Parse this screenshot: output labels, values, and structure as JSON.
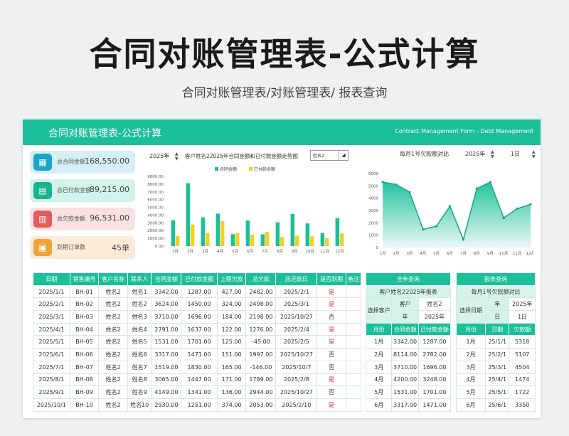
{
  "hero": {
    "title": "合同对账管理表-公式计算",
    "subtitle": "合同对账管理表/对账管理表/ 报表查询"
  },
  "header": {
    "title": "合同对账管理表-公式计算",
    "subtitle": "Contract Management Form - Debt Management"
  },
  "cards": [
    {
      "label": "总合同金额",
      "value": "168,550.00",
      "bg": "#d6eef6",
      "icon_bg": "#1aa6c8",
      "icon": "table-icon"
    },
    {
      "label": "总已付款金额",
      "value": "89,215.00",
      "bg": "#d3f3ea",
      "icon_bg": "#17b58e",
      "icon": "document-icon"
    },
    {
      "label": "总欠款金额",
      "value": "96,531.00",
      "bg": "#fae0e0",
      "icon_bg": "#e25c5c",
      "icon": "chart-icon"
    },
    {
      "label": "到期订单数",
      "value": "45单",
      "bg": "#fcebd7",
      "icon_bg": "#f0a33a",
      "icon": "calendar-icon"
    }
  ],
  "chart1": {
    "year": "2025年",
    "title": "客户姓名22025年合同金额和已付款金额走势图",
    "select": "姓名2"
  },
  "chart2": {
    "title": "每月1号欠款额对比",
    "year": "2025年",
    "day": "1日"
  },
  "chart_data": [
    {
      "type": "bar",
      "title": "客户姓名22025年合同金额和已付款金额走势图",
      "categories": [
        "1月",
        "2月",
        "3月",
        "4月",
        "5月",
        "6月",
        "7月",
        "8月",
        "9月",
        "10月",
        "11月",
        "12月"
      ],
      "yticks": [
        "9000.00",
        "8000.00",
        "7000.00",
        "6000.00",
        "5000.00",
        "4000.00",
        "3000.00",
        "2000.00",
        "1000.00",
        "0.00"
      ],
      "ylim": [
        0,
        9000
      ],
      "legend_position": "top",
      "series": [
        {
          "name": "合同金额",
          "color": "#1bbf98",
          "values": [
            3342,
            8114,
            3710,
            4200,
            1531,
            3317,
            1519,
            3065,
            4149,
            2930,
            1680,
            3620
          ]
        },
        {
          "name": "已付款金额",
          "color": "#f2d024",
          "values": [
            1287,
            2782,
            1696,
            3248,
            1701,
            1471,
            1830,
            1147,
            1341,
            1251,
            1050,
            1620
          ]
        }
      ]
    },
    {
      "type": "area",
      "title": "每月1号欠款额对比",
      "categories": [
        "1月",
        "2月",
        "3月",
        "4月",
        "5月",
        "6月",
        "7月",
        "8月",
        "9月",
        "10月",
        "11月",
        "12月"
      ],
      "yticks": [
        "6000",
        "5000",
        "4000",
        "3000",
        "2000",
        "1000",
        "0"
      ],
      "ylim": [
        0,
        6000
      ],
      "values": [
        5318,
        5107,
        4504,
        1474,
        1722,
        3350,
        650,
        4780,
        5300,
        2400,
        3150,
        3500
      ]
    }
  ],
  "main_table": {
    "headers": [
      "日期",
      "销售编号",
      "客户名称",
      "联系人",
      "合同金额",
      "已付款金额",
      "上期欠款",
      "总欠款",
      "应还款日",
      "是否到期",
      "备注"
    ],
    "rows": [
      [
        "2025/1/1",
        "BH-01",
        "姓名2",
        "姓名1",
        "3342.00",
        "1287.00",
        "427.00",
        "2482.00",
        "2025/2/1",
        "是",
        ""
      ],
      [
        "2025/2/1",
        "BH-02",
        "姓名2",
        "姓名2",
        "3624.00",
        "1450.00",
        "324.00",
        "2498.00",
        "2025/3/1",
        "是",
        ""
      ],
      [
        "2025/3/1",
        "BH-03",
        "姓名2",
        "姓名3",
        "3710.00",
        "1696.00",
        "184.00",
        "2198.00",
        "2025/10/27",
        "否",
        ""
      ],
      [
        "2025/4/1",
        "BH-04",
        "姓名2",
        "姓名4",
        "2791.00",
        "1637.00",
        "122.00",
        "1276.00",
        "2025/2/4",
        "是",
        ""
      ],
      [
        "2025/5/1",
        "BH-05",
        "姓名2",
        "姓名5",
        "1531.00",
        "1701.00",
        "125.00",
        "-45.00",
        "2025/2/5",
        "是",
        ""
      ],
      [
        "2025/6/1",
        "BH-06",
        "姓名2",
        "姓名6",
        "3317.00",
        "1471.00",
        "151.00",
        "1997.00",
        "2025/10/27",
        "否",
        ""
      ],
      [
        "2025/7/1",
        "BH-07",
        "姓名2",
        "姓名7",
        "1519.00",
        "1830.00",
        "165.00",
        "-146.00",
        "2025/10/7",
        "否",
        ""
      ],
      [
        "2025/8/1",
        "BH-08",
        "姓名2",
        "姓名8",
        "3065.00",
        "1447.00",
        "171.00",
        "1789.00",
        "2025/2/8",
        "是",
        ""
      ],
      [
        "2025/9/1",
        "BH-09",
        "姓名2",
        "姓名9",
        "4149.00",
        "1341.00",
        "136.00",
        "2944.00",
        "2025/10/27",
        "否",
        ""
      ],
      [
        "2025/10/1",
        "BH-10",
        "姓名2",
        "姓名10",
        "2930.00",
        "1251.00",
        "374.00",
        "2053.00",
        "2025/2/10",
        "是",
        ""
      ]
    ]
  },
  "year_query": {
    "title": "全年查询",
    "subtitle": "客户姓名22025年报表",
    "customer_label": "选择客户",
    "customer": "姓名2",
    "year_label": "年",
    "year": "2025年",
    "headers": [
      "月份",
      "合同金额",
      "已付款金额"
    ],
    "rows": [
      [
        "1月",
        "3342.00",
        "1287.00"
      ],
      [
        "2月",
        "8114.00",
        "2782.00"
      ],
      [
        "3月",
        "3710.00",
        "1696.00"
      ],
      [
        "4月",
        "4200.00",
        "3248.00"
      ],
      [
        "5月",
        "1531.00",
        "1701.00"
      ],
      [
        "6月",
        "3317.00",
        "1471.00"
      ]
    ]
  },
  "report_query": {
    "title": "报表查询",
    "subtitle": "每月1号欠款额对比",
    "date_label": "选择日期",
    "year_label": "年",
    "year": "2025年",
    "day_label": "日",
    "day": "1日",
    "headers": [
      "月份",
      "日期",
      "欠款额"
    ],
    "rows": [
      [
        "1月",
        "25/1/1",
        "5318"
      ],
      [
        "2月",
        "25/2/1",
        "5107"
      ],
      [
        "3月",
        "25/3/1",
        "4504"
      ],
      [
        "4月",
        "25/4/1",
        "1474"
      ],
      [
        "5月",
        "25/5/1",
        "1722"
      ],
      [
        "6月",
        "25/6/1",
        "3350"
      ]
    ]
  }
}
